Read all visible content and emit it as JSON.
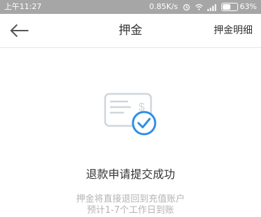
{
  "status_bar": {
    "time": "上午11:27",
    "network_speed": "0.85K/s",
    "battery_percent_label": "63%",
    "battery_level": 0.63,
    "icons": [
      "alarm-icon",
      "wifi-icon",
      "signal-icon",
      "battery-icon"
    ]
  },
  "nav": {
    "back_icon": "arrow-left-icon",
    "title": "押金",
    "right_link": "押金明细"
  },
  "result": {
    "icon": "deposit-refund-success-icon",
    "title": "退款申请提交成功",
    "line1": "押金将直接退回到充值账户",
    "line2": "预计1-7个工作日到账"
  },
  "colors": {
    "status_bar_bg": "#a6a6a6",
    "accent_blue": "#2f8ee8",
    "text_dark": "#333333",
    "text_light": "#b3b3b3",
    "icon_gray": "#cfd6dd"
  }
}
